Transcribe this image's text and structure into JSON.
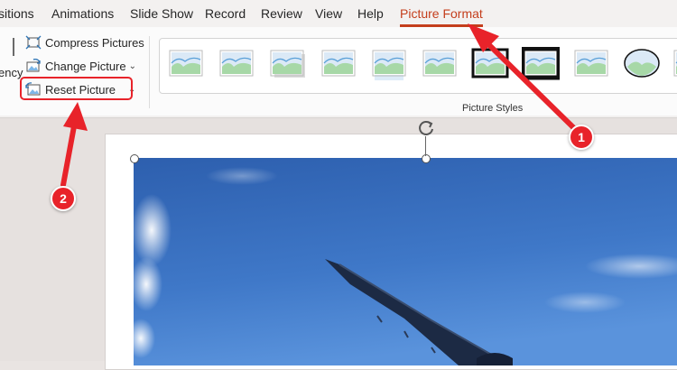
{
  "tabs": [
    {
      "label": "sitions"
    },
    {
      "label": "Animations"
    },
    {
      "label": "Slide Show"
    },
    {
      "label": "Record"
    },
    {
      "label": "Review"
    },
    {
      "label": "View"
    },
    {
      "label": "Help"
    },
    {
      "label": "Picture Format",
      "active": true
    }
  ],
  "ribbon": {
    "left_fragment": "ency",
    "adjust_commands": {
      "compress": "Compress Pictures",
      "change": "Change Picture",
      "reset": "Reset Picture"
    },
    "styles_group_label": "Picture Styles"
  },
  "callouts": {
    "one": "1",
    "two": "2"
  },
  "colors": {
    "accent": "#c43e1c",
    "callout": "#e8232a"
  }
}
